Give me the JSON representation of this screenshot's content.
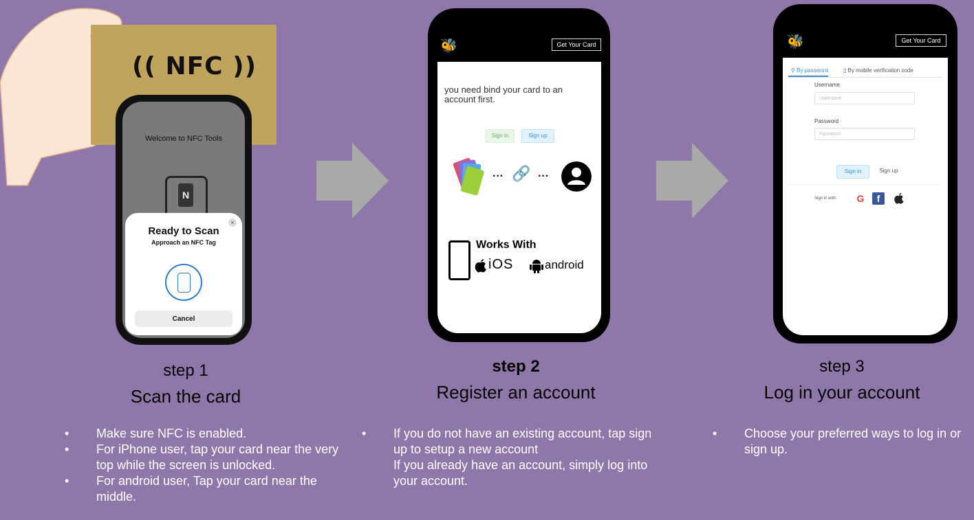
{
  "step1": {
    "nfc_logo": "(( NFC ))",
    "phone": {
      "welcome": "Welcome to NFC Tools",
      "nfc_glyph": "N",
      "sheet_title": "Ready to Scan",
      "sheet_subtitle": "Approach an NFC Tag",
      "close_glyph": "×",
      "cancel_label": "Cancel"
    },
    "step_label": "step 1",
    "title": "Scan the card",
    "bullets": [
      "Make sure NFC is enabled.",
      "For iPhone user, tap your card near the very top while the screen is unlocked.",
      " For android user, Tap your card near the middle."
    ]
  },
  "step2": {
    "phone": {
      "logo": "🐝",
      "get_card_label": "Get Your Card",
      "bind_text": "you need bind your card to an account first.",
      "signin_label": "Sign in",
      "signup_label": "Sign up",
      "dots": "···",
      "link_glyph": "🔗",
      "works_with": "Works With",
      "ios_label": "iOS",
      "android_label": "android"
    },
    "step_label": "step 2",
    "title": "Register an account",
    "bullet": "If you do not have an existing account, tap sign up to setup a new account",
    "bullet_cont": " If you already have an account, simply log into your account."
  },
  "step3": {
    "phone": {
      "logo": "🐝",
      "get_card_label": "Get Your Card",
      "tab_password": "By password",
      "tab_mobile": "By mobile verification code",
      "username_label": "Username",
      "username_placeholder": "Username",
      "password_label": "Password",
      "password_placeholder": "Password",
      "signin_label": "Sign in",
      "signup_label": "Sign up",
      "sign_in_with": "Sign in with:",
      "google": "G",
      "facebook": "f",
      "apple": ""
    },
    "step_label": "step 3",
    "title": "Log in your account",
    "bullet": " Choose your preferred ways to log in or sign up."
  },
  "colors": {
    "background": "#8f78a9",
    "card_gold": "#c0a45e",
    "accent_blue": "#3a8fd0",
    "signin_green": "#58b15a",
    "arrow_gray": "#a9a9a9"
  }
}
